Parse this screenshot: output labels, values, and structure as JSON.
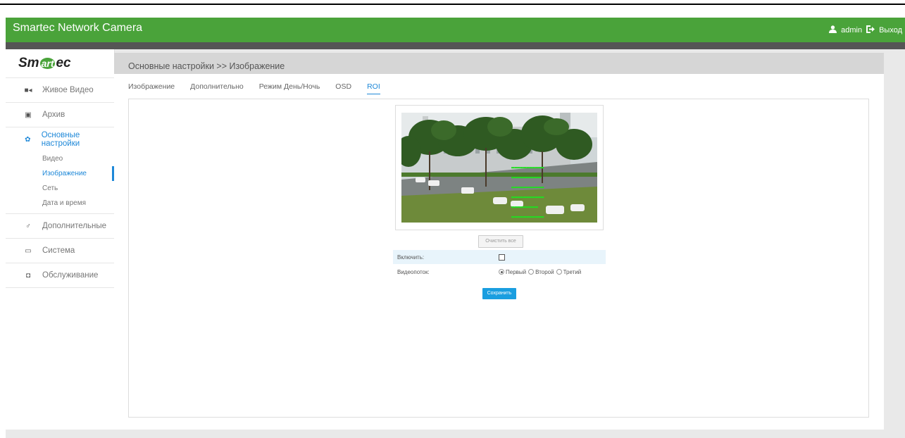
{
  "header": {
    "title": "Smartec Network Camera",
    "user": "admin",
    "logout": "Выход"
  },
  "logo": {
    "part1": "Sm",
    "part2": "art",
    "part3": "ec"
  },
  "sidebar": {
    "items": [
      {
        "label": "Живое Видео",
        "icon": "video-icon"
      },
      {
        "label": "Архив",
        "icon": "archive-icon"
      },
      {
        "label": "Основные настройки",
        "icon": "gear-icon",
        "active": true
      },
      {
        "label": "Дополнительные",
        "icon": "plug-icon"
      },
      {
        "label": "Система",
        "icon": "monitor-icon"
      },
      {
        "label": "Обслуживание",
        "icon": "toolbox-icon"
      }
    ],
    "subitems": [
      {
        "label": "Видео"
      },
      {
        "label": "Изображение",
        "active": true
      },
      {
        "label": "Сеть"
      },
      {
        "label": "Дата и время"
      }
    ]
  },
  "breadcrumb": "Основные настройки >> Изображение",
  "tabs": [
    "Изображение",
    "Дополнительно",
    "Режим День/Ночь",
    "OSD",
    "ROI"
  ],
  "active_tab": "ROI",
  "roi": {
    "clear_label": "Очистить все",
    "enable_label": "Включить:",
    "enable_checked": false,
    "stream_label": "Видеопоток:",
    "streams": [
      "Первый",
      "Второй",
      "Третий"
    ],
    "selected_stream": "Первый",
    "save_label": "Сохранить"
  },
  "colors": {
    "header": "#4aa33a",
    "accent": "#1e88d8",
    "save_button": "#1a9ee0"
  }
}
